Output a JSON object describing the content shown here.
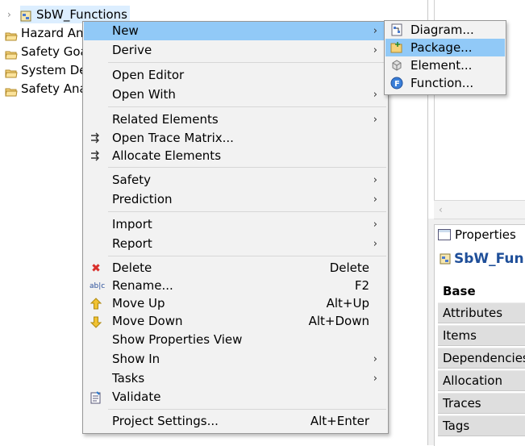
{
  "tree": {
    "root": {
      "label": "SbW_Functions"
    },
    "items": [
      {
        "label": "Hazard An"
      },
      {
        "label": "Safety Goa"
      },
      {
        "label": "System De"
      },
      {
        "label": "Safety Ana"
      }
    ]
  },
  "properties": {
    "tab_label": "Properties",
    "title": "SbW_Fun",
    "tabs": [
      "Base",
      "Attributes",
      "Items",
      "Dependencies",
      "Allocation",
      "Traces",
      "Tags"
    ],
    "active_tab": "Base"
  },
  "context_menu": {
    "items": {
      "new": {
        "label": "New"
      },
      "derive": {
        "label": "Derive"
      },
      "open_editor": {
        "label": "Open Editor"
      },
      "open_with": {
        "label": "Open With"
      },
      "related_elements": {
        "label": "Related Elements"
      },
      "open_trace_matrix": {
        "label": "Open Trace Matrix..."
      },
      "allocate_elements": {
        "label": "Allocate Elements"
      },
      "safety": {
        "label": "Safety"
      },
      "prediction": {
        "label": "Prediction"
      },
      "import": {
        "label": "Import"
      },
      "report": {
        "label": "Report"
      },
      "delete": {
        "label": "Delete",
        "shortcut": "Delete"
      },
      "rename": {
        "label": "Rename...",
        "shortcut": "F2"
      },
      "move_up": {
        "label": "Move Up",
        "shortcut": "Alt+Up"
      },
      "move_down": {
        "label": "Move Down",
        "shortcut": "Alt+Down"
      },
      "show_properties_view": {
        "label": "Show Properties View"
      },
      "show_in": {
        "label": "Show In"
      },
      "tasks": {
        "label": "Tasks"
      },
      "validate": {
        "label": "Validate"
      },
      "project_settings": {
        "label": "Project Settings...",
        "shortcut": "Alt+Enter"
      }
    },
    "highlighted": "New"
  },
  "submenu_new": {
    "items": {
      "diagram": {
        "label": "Diagram..."
      },
      "package": {
        "label": "Package..."
      },
      "element": {
        "label": "Element..."
      },
      "function": {
        "label": "Function..."
      }
    },
    "highlighted": "Package..."
  },
  "colors": {
    "menu_bg": "#f2f2f2",
    "highlight": "#91c9f7",
    "title_blue": "#1f4f99",
    "delete_red": "#d9302c",
    "arrow_yellow": "#f1c232"
  }
}
